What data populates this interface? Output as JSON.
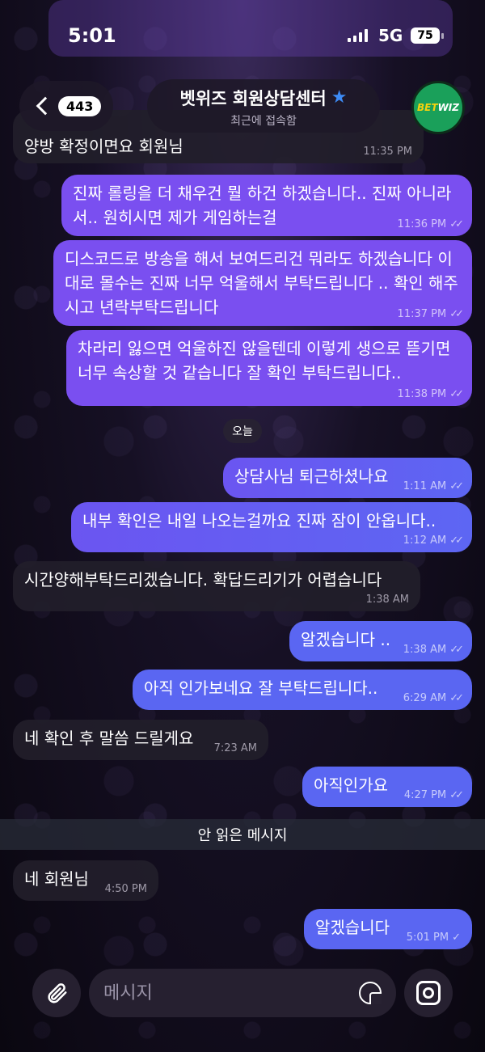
{
  "status_bar": {
    "time": "5:01",
    "network": "5G",
    "battery": "75"
  },
  "header": {
    "back_count": "443",
    "title": "벳위즈 회원상담센터",
    "subtitle": "최근에 접속함",
    "avatar_text_a": "BET",
    "avatar_text_b": "WIZ"
  },
  "partial_message": {
    "text": "양방 확정이면요 회원님",
    "time": "11:35 PM"
  },
  "messages": [
    {
      "direction": "out",
      "text": "진짜 롤링을 더 채우건 뭘 하건 하겠습니다.. 진짜 아니라서.. 원히시면 제가 게임하는걸",
      "time": "11:36 PM"
    },
    {
      "direction": "out",
      "text": "디스코드로 방송을 해서 보여드리건 뭐라도 하겠습니다 이대로 몰수는 진짜 너무 억울해서 부탁드립니다 .. 확인 해주시고 년락부탁드립니다",
      "time": "11:37 PM"
    },
    {
      "direction": "out",
      "text": "차라리 잃으면 억울하진 않을텐데 이렇게 생으로 뜯기면 너무 속상할 것 같습니다 잘 확인 부탁드립니다..",
      "time": "11:38 PM"
    },
    {
      "direction": "out",
      "text": "상담사님 퇴근하셨나요",
      "time": "1:11 AM"
    },
    {
      "direction": "out",
      "text": "내부 확인은 내일 나오는걸까요 진짜 잠이 안옵니다..",
      "time": "1:12 AM"
    },
    {
      "direction": "in",
      "text": "시간양해부탁드리겠습니다. 확답드리기가 어렵습니다",
      "time": "1:38 AM"
    },
    {
      "direction": "out",
      "text": "알겠습니다 ..",
      "time": "1:38 AM"
    },
    {
      "direction": "out",
      "text": "아직 인가보네요 잘 부탁드립니다..",
      "time": "6:29 AM"
    },
    {
      "direction": "in",
      "text": "네 확인 후 말씀 드릴게요",
      "time": "7:23 AM"
    },
    {
      "direction": "out",
      "text": "아직인가요",
      "time": "4:27 PM"
    },
    {
      "direction": "in",
      "text": "네 회원님",
      "time": "4:50 PM"
    },
    {
      "direction": "out",
      "text": "알겠습니다",
      "time": "5:01 PM"
    }
  ],
  "date_divider": "오늘",
  "unread_divider": "안 읽은 메시지",
  "composer": {
    "placeholder": "메시지"
  },
  "colors": {
    "outgoing": "#7a4ff0",
    "outgoing_blue": "#5a66f2",
    "incoming": "#221e2a",
    "star": "#3d8bf5"
  },
  "icons": [
    "paperclip-icon",
    "sticker-icon",
    "camera-icon",
    "star-icon",
    "chevron-left-icon",
    "read-ticks-icon",
    "sent-tick-icon"
  ]
}
